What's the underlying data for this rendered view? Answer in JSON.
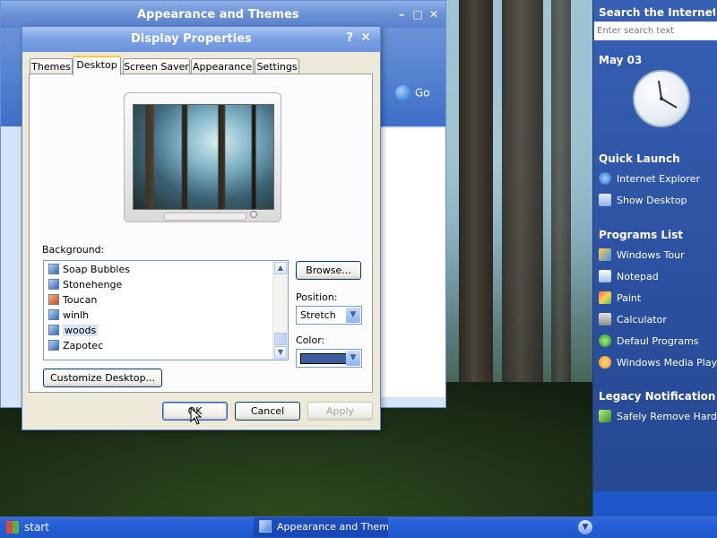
{
  "background_window": {
    "title": "Appearance and Themes",
    "go_label": "Go",
    "controls": {
      "minimize": "–",
      "maximize": "□",
      "close": "✕"
    }
  },
  "dialog": {
    "title": "Display Properties",
    "help": "?",
    "close": "✕",
    "tabs": [
      {
        "label": "Themes",
        "active": false
      },
      {
        "label": "Desktop",
        "active": true
      },
      {
        "label": "Screen Saver",
        "active": false
      },
      {
        "label": "Appearance",
        "active": false
      },
      {
        "label": "Settings",
        "active": false
      }
    ],
    "background_label": "Background:",
    "backgrounds": [
      {
        "name": "Soap Bubbles",
        "selected": false
      },
      {
        "name": "Stonehenge",
        "selected": false
      },
      {
        "name": "Toucan",
        "selected": false
      },
      {
        "name": "winlh",
        "selected": false
      },
      {
        "name": "woods",
        "selected": true
      },
      {
        "name": "Zapotec",
        "selected": false
      }
    ],
    "browse_label": "Browse...",
    "position_label": "Position:",
    "position_value": "Stretch",
    "color_label": "Color:",
    "color_value": "#3a5f9c",
    "customize_label": "Customize Desktop...",
    "ok_label": "OK",
    "cancel_label": "Cancel",
    "apply_label": "Apply"
  },
  "sidebar": {
    "search_title": "Search the Internet",
    "search_placeholder": "Enter search text",
    "date": "May 03",
    "quick_launch_title": "Quick Launch",
    "quick_launch": [
      "Internet Explorer",
      "Show Desktop"
    ],
    "programs_title": "Programs List",
    "programs": [
      "Windows Tour",
      "Notepad",
      "Paint",
      "Calculator",
      "Defaul Programs",
      "Windows Media Player"
    ],
    "legacy_title": "Legacy Notifications",
    "legacy": [
      "Safely Remove Hardware"
    ]
  },
  "taskbar": {
    "start_label": "start",
    "task_label": "Appearance and Themes",
    "tray_icon": "chevron-down-icon"
  }
}
